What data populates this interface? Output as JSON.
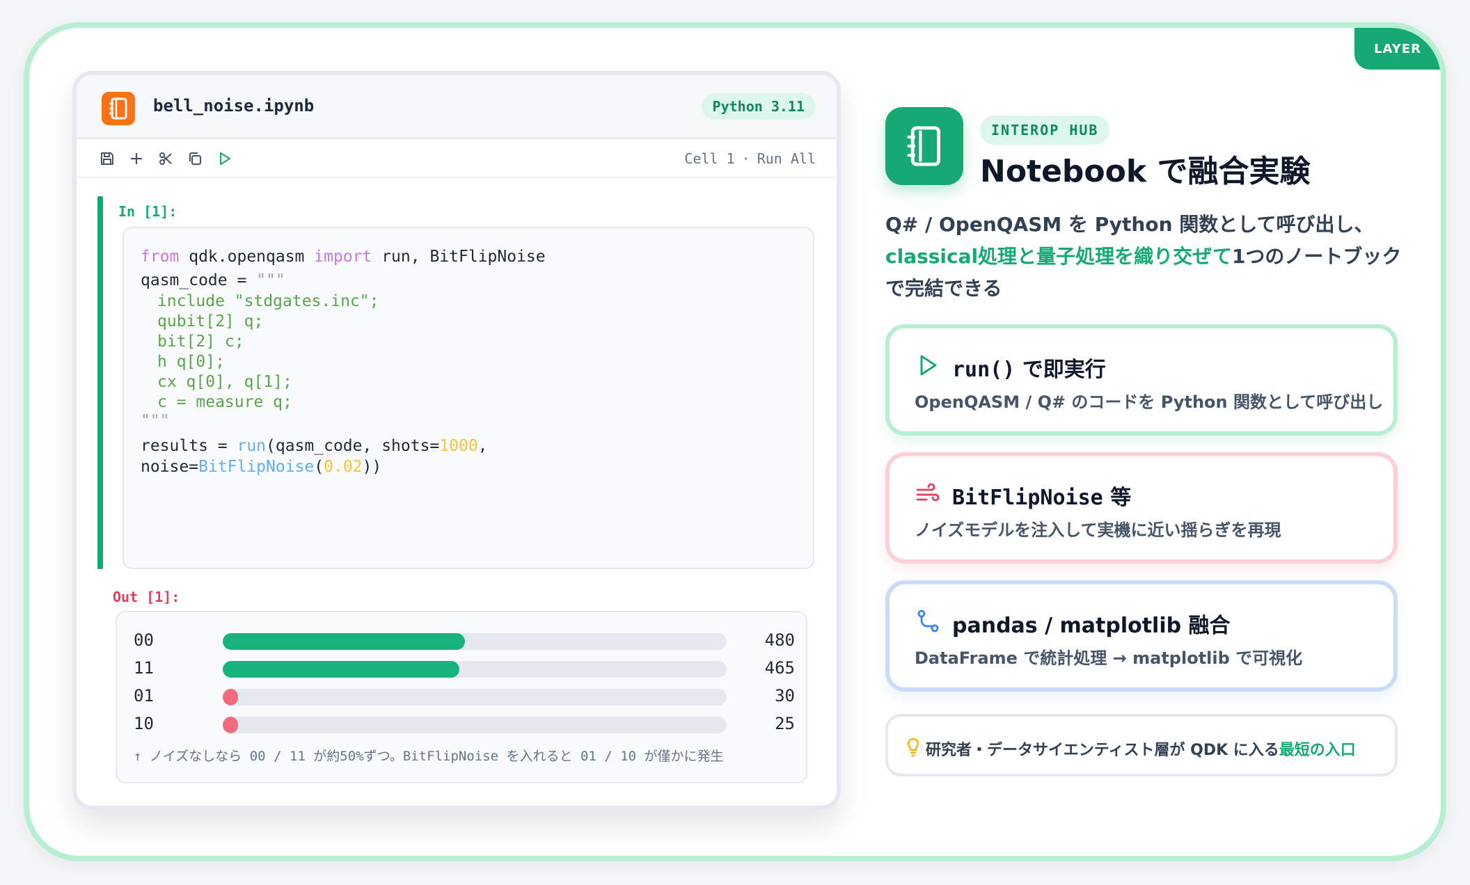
{
  "badge": "LAYER",
  "notebook": {
    "filename": "bell_noise.ipynb",
    "kernel": "Python 3.11",
    "toolbar_icons": [
      "save-icon",
      "plus-icon",
      "scissors-icon",
      "copy-icon",
      "play-icon"
    ],
    "cell_label": "Cell 1",
    "separator": "·",
    "run_all": "Run All",
    "in_label": "In [1]:",
    "out_label": "Out [1]:",
    "code": {
      "l1_kw1": "from",
      "l1_mod": " qdk.openqasm ",
      "l1_kw2": "import",
      "l1_rest": " run, BitFlipNoise",
      "l2_var": "qasm_code = ",
      "l2_dq": "\"\"\"",
      "l3": "include \"stdgates.inc\";",
      "l4": "qubit[2] q;",
      "l5": "bit[2] c;",
      "l6": "h q[0];",
      "l7": "cx q[0], q[1];",
      "l8": "c = measure q;",
      "l9": "\"\"\"",
      "l10_a": "results = ",
      "l10_fn": "run",
      "l10_b": "(qasm_code, shots=",
      "l10_num": "1000",
      "l10_c": ",",
      "l11_a": "noise=",
      "l11_fn": "BitFlipNoise",
      "l11_b": "(",
      "l11_num": "0.02",
      "l11_c": "))"
    },
    "results": [
      {
        "key": "00",
        "value": "480",
        "fraction": 0.48,
        "color": "#16b47a"
      },
      {
        "key": "11",
        "value": "465",
        "fraction": 0.47,
        "color": "#16b47a"
      },
      {
        "key": "01",
        "value": "30",
        "fraction": 0.03,
        "color": "#f06b80"
      },
      {
        "key": "10",
        "value": "25",
        "fraction": 0.03,
        "color": "#f06b80"
      }
    ],
    "out_note": "↑ ノイズなしなら 00 / 11 が約50%ずつ。BitFlipNoise を入れると 01 / 10 が僅かに発生"
  },
  "hub": {
    "pill": "INTEROP HUB",
    "title": "Notebook で融合実験",
    "desc_1": "Q# / OpenQASM を Python 関数として呼び出し、",
    "desc_hl": "classical処理と量子処理を織り交ぜて",
    "desc_2": "1つのノートブック",
    "desc_3": "で完結できる"
  },
  "cards": [
    {
      "icon": "play-icon",
      "title_mono": "run()",
      "title_rest": " で即実行",
      "sub": "OpenQASM / Q# のコードを Python 関数として呼び出し"
    },
    {
      "icon": "wind-icon",
      "title_mono": "BitFlipNoise",
      "title_rest": " 等",
      "sub": "ノイズモデルを注入して実機に近い揺らぎを再現"
    },
    {
      "icon": "graph-icon",
      "title_mono": "",
      "title_rest": "pandas / matplotlib 融合",
      "sub": "DataFrame で統計処理 → matplotlib で可視化"
    }
  ],
  "tip": {
    "icon": "lightbulb-icon",
    "text": "研究者・データサイエンティスト層が QDK に入る",
    "hl": "最短の入口"
  },
  "colors": {
    "accent": "#16a974",
    "noise": "#e23d5f",
    "orange": "#f97316"
  }
}
